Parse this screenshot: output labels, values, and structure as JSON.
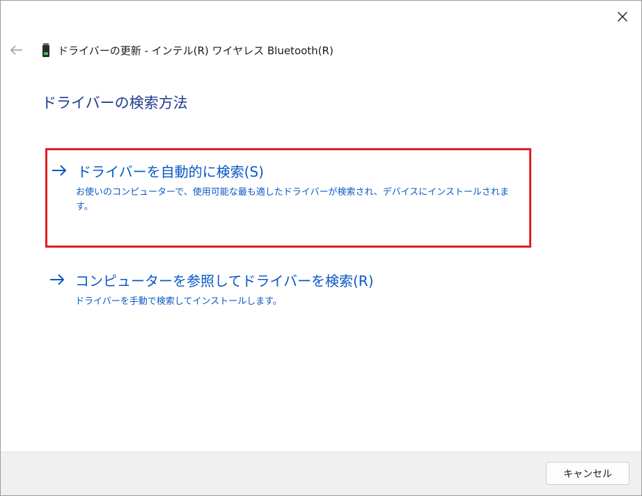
{
  "window": {
    "close_icon": "close-icon"
  },
  "header": {
    "back_icon": "back-arrow-icon",
    "device_icon": "usb-device-icon",
    "title": "ドライバーの更新 - インテル(R) ワイヤレス Bluetooth(R)"
  },
  "main": {
    "title": "ドライバーの検索方法",
    "options": [
      {
        "title": "ドライバーを自動的に検索(S)",
        "description": "お使いのコンピューターで、使用可能な最も適したドライバーが検索され、デバイスにインストールされます。",
        "highlighted": true
      },
      {
        "title": "コンピューターを参照してドライバーを検索(R)",
        "description": "ドライバーを手動で検索してインストールします。",
        "highlighted": false
      }
    ]
  },
  "footer": {
    "cancel_label": "キャンセル"
  },
  "colors": {
    "link_blue": "#0a58c4",
    "title_blue": "#1f3a8f",
    "highlight_red": "#e31b23",
    "footer_bg": "#f0f0f0"
  }
}
